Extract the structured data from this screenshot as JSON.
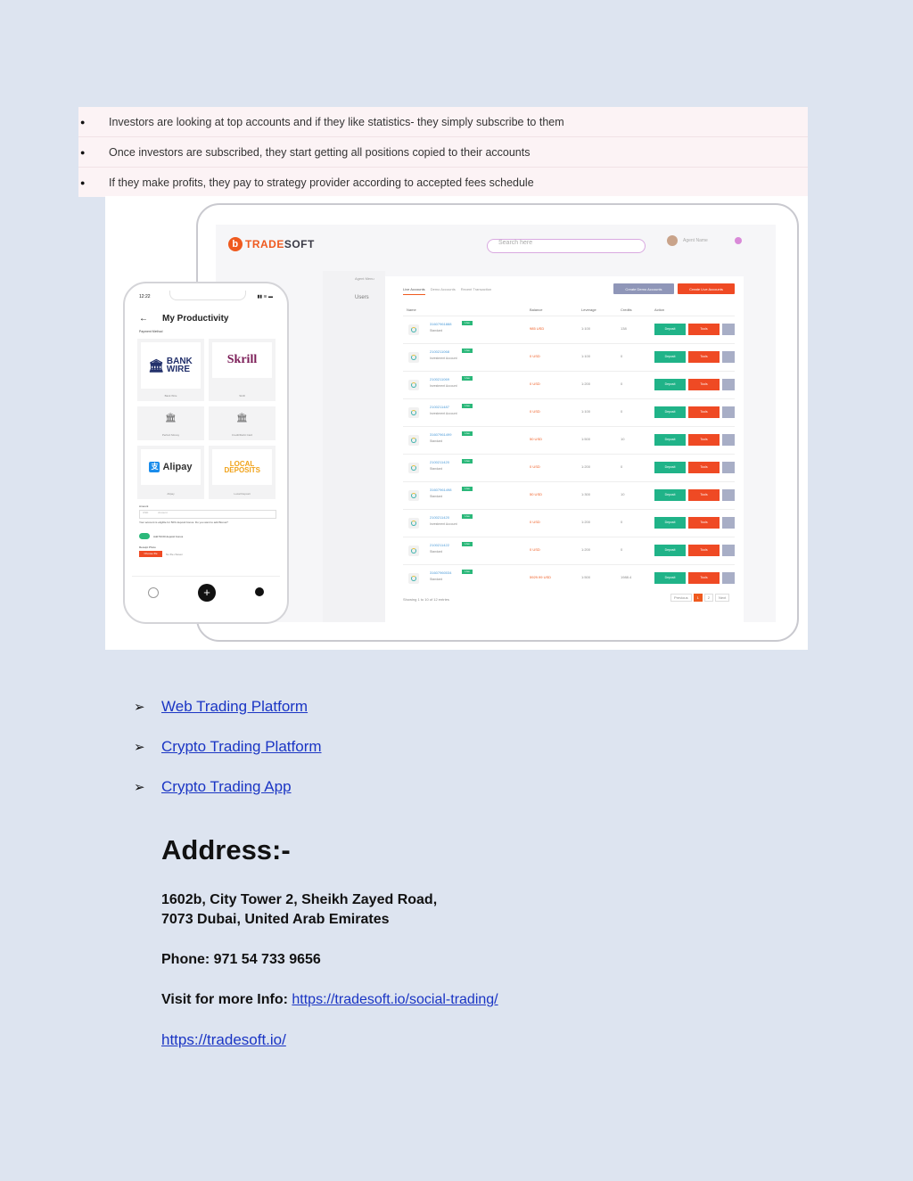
{
  "bullets": [
    "Investors are looking at top accounts and if they like statistics- they simply subscribe to them",
    "Once investors are subscribed, they start getting all positions copied to their accounts",
    "If they make profits, they pay to strategy provider according to accepted fees schedule"
  ],
  "hero": {
    "logo_mark": "b",
    "logo_part1": "TRADE",
    "logo_part2": "SOFT",
    "search_placeholder": "Search here",
    "agent_name": "Agent Name",
    "side_top": "Agent Menu",
    "side_item": "Users",
    "tabs": [
      "Live Accounts",
      "Demo Accounts",
      "Recent Transaction"
    ],
    "btn_demo": "Create Demo Accounts",
    "btn_live": "Create Live Accounts",
    "headers": [
      "Name",
      "Balance",
      "Leverage",
      "Credits",
      "Action"
    ],
    "rows": [
      {
        "acc": "31607961888",
        "sub": "Standard",
        "bal": "985 USD",
        "lev": "1:100",
        "cr": "138"
      },
      {
        "acc": "2100211068",
        "sub": "Investment Account",
        "bal": "0 USD",
        "lev": "1:100",
        "cr": "0"
      },
      {
        "acc": "2100211069",
        "sub": "Investment Account",
        "bal": "0 USD",
        "lev": "1:200",
        "cr": "0"
      },
      {
        "acc": "2100211487",
        "sub": "Investment Account",
        "bal": "0 USD",
        "lev": "1:100",
        "cr": "0"
      },
      {
        "acc": "31607961499",
        "sub": "Standard",
        "bal": "50 USD",
        "lev": "1:500",
        "cr": "10"
      },
      {
        "acc": "2100211420",
        "sub": "Standard",
        "bal": "0 USD",
        "lev": "1:200",
        "cr": "0"
      },
      {
        "acc": "31607961498",
        "sub": "Standard",
        "bal": "50 USD",
        "lev": "1:300",
        "cr": "10"
      },
      {
        "acc": "2100211420",
        "sub": "Investment Account",
        "bal": "0 USD",
        "lev": "1:200",
        "cr": "0"
      },
      {
        "acc": "2100211422",
        "sub": "Standard",
        "bal": "0 USD",
        "lev": "1:200",
        "cr": "0"
      },
      {
        "acc": "31607960034",
        "sub": "Standard",
        "bal": "5929.99 USD",
        "lev": "1:500",
        "cr": "1988.4"
      }
    ],
    "live_badge": "Live",
    "deposit_label": "Deposit",
    "tools_label": "Tools",
    "showing": "Showing 1 to 10 of 12 entries",
    "pager": [
      "Previous",
      "1",
      "2",
      "Next"
    ],
    "phone": {
      "time": "12:22",
      "status": "▮▮ ≋ ▬",
      "back": "←",
      "title": "My Productivity",
      "payment_method": "Payment Method",
      "bank_wire": "BANK WIRE",
      "bank_wire_caption": "Bank Wire",
      "skrill": "Skrill",
      "skrill_caption": "Skrill",
      "perfect_money_caption": "Perfect Money",
      "card_caption": "Credit/Debit Card",
      "alipay": "Alipay",
      "alipay_caption": "Alipay",
      "local": "LOCAL DEPOSITS",
      "local_caption": "Local Deposit",
      "amount": "Amount",
      "amount_currency": "USD",
      "amount_placeholder": "Amount",
      "note": "Your account is eligible for 50% deposit bonus. Do you want to add Bonus?",
      "toggle_label": "Add 50.00 deposit bonus",
      "receipt": "Receipt Photo",
      "choose": "Choose file",
      "nofile": "No file chosen",
      "plus": "+"
    }
  },
  "links": [
    {
      "label": "Web Trading Platform"
    },
    {
      "label": "Crypto Trading Platform"
    },
    {
      "label": "Crypto Trading App"
    }
  ],
  "address": {
    "title": "Address:-",
    "line1": "1602b, City Tower 2, Sheikh Zayed Road,",
    "line2": "7073 Dubai, United Arab Emirates",
    "phone": "Phone:  971 54 733 9656",
    "visit_label": "Visit for more Info: ",
    "visit_url": "https://tradesoft.io/social-trading/",
    "home_url": "https://tradesoft.io/"
  }
}
